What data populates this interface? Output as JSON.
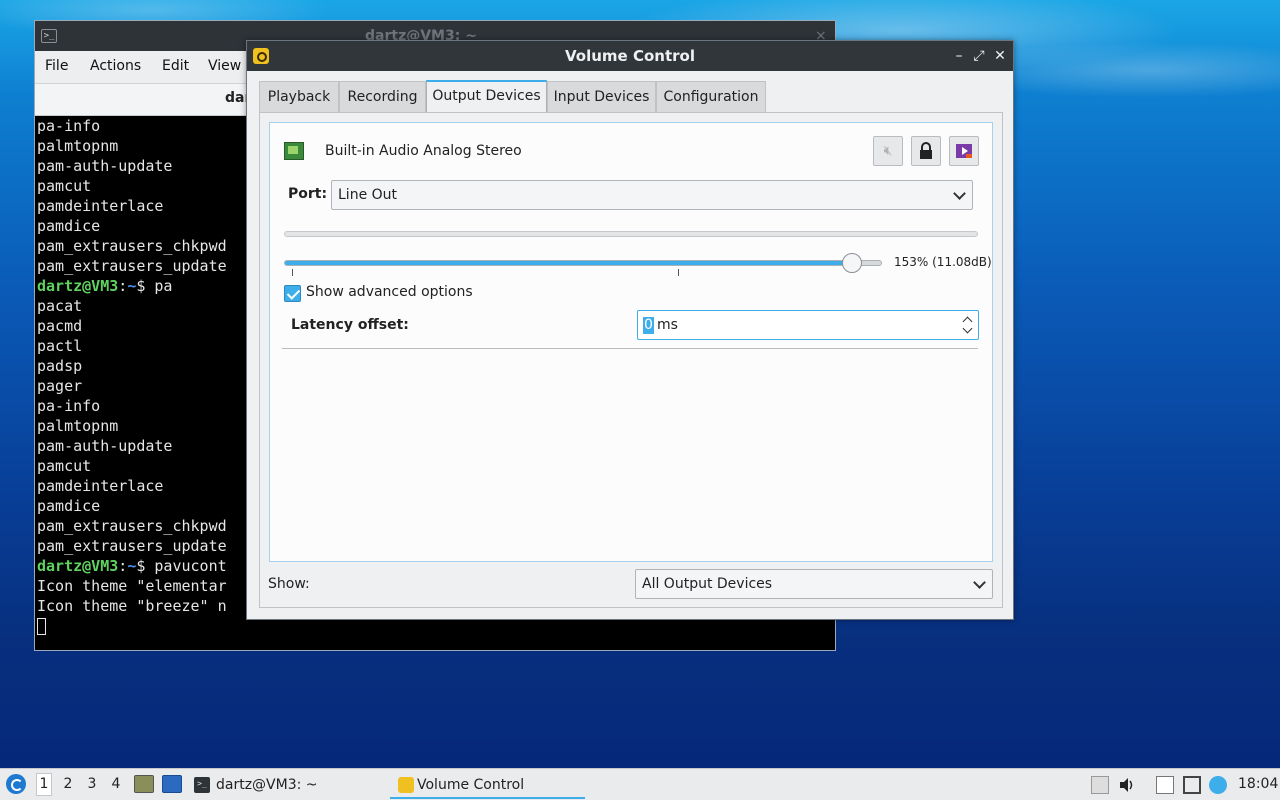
{
  "terminal": {
    "title": "dartz@VM3: ~",
    "close_glyph": "×",
    "menu": [
      "File",
      "Actions",
      "Edit",
      "View"
    ],
    "tab_label": "dar",
    "lines": [
      {
        "type": "text",
        "text": "pa-info"
      },
      {
        "type": "text",
        "text": "palmtopnm"
      },
      {
        "type": "text",
        "text": "pam-auth-update"
      },
      {
        "type": "text",
        "text": "pamcut"
      },
      {
        "type": "text",
        "text": "pamdeinterlace"
      },
      {
        "type": "text",
        "text": "pamdice"
      },
      {
        "type": "text",
        "text": "pam_extrausers_chkpwd"
      },
      {
        "type": "text",
        "text": "pam_extrausers_update"
      },
      {
        "type": "prompt",
        "user": "dartz@VM3",
        "path": "~",
        "cmd": " pa"
      },
      {
        "type": "text",
        "text": "pacat"
      },
      {
        "type": "text",
        "text": "pacmd"
      },
      {
        "type": "text",
        "text": "pactl"
      },
      {
        "type": "text",
        "text": "padsp"
      },
      {
        "type": "text",
        "text": "pager"
      },
      {
        "type": "text",
        "text": "pa-info"
      },
      {
        "type": "text",
        "text": "palmtopnm"
      },
      {
        "type": "text",
        "text": "pam-auth-update"
      },
      {
        "type": "text",
        "text": "pamcut"
      },
      {
        "type": "text",
        "text": "pamdeinterlace"
      },
      {
        "type": "text",
        "text": "pamdice"
      },
      {
        "type": "text",
        "text": "pam_extrausers_chkpwd"
      },
      {
        "type": "text",
        "text": "pam_extrausers_update"
      },
      {
        "type": "prompt",
        "user": "dartz@VM3",
        "path": "~",
        "cmd": " pavucont"
      },
      {
        "type": "text",
        "text": "Icon theme \"elementar"
      },
      {
        "type": "text",
        "text": "Icon theme \"breeze\" n"
      },
      {
        "type": "cursor"
      }
    ]
  },
  "volume_control": {
    "title": "Volume Control",
    "window_buttons": {
      "minimize": "–",
      "maximize": "⤢",
      "close": "✕"
    },
    "tabs": [
      "Playback",
      "Recording",
      "Output Devices",
      "Input Devices",
      "Configuration"
    ],
    "active_tab": "Output Devices",
    "device": {
      "name": "Built-in Audio Analog Stereo",
      "port_label": "Port:",
      "port_value": "Line Out",
      "volume_text": "153% (11.08dB)",
      "volume_fraction": 0.95,
      "show_advanced_label": "Show advanced options",
      "show_advanced_checked": true,
      "latency_label": "Latency offset:",
      "latency_value": "0",
      "latency_unit": "ms"
    },
    "show_label": "Show:",
    "show_value": "All Output Devices"
  },
  "taskbar": {
    "workspaces": [
      "1",
      "2",
      "3",
      "4"
    ],
    "active_workspace": "1",
    "tasks": [
      {
        "label": "dartz@VM3: ~",
        "icon": "terminal-icon"
      },
      {
        "label": "Volume Control",
        "icon": "volume-control-icon"
      }
    ],
    "clock": "18:04"
  },
  "colors": {
    "accent": "#3daee9",
    "titlebar": "#31363b",
    "prompt_user": "#5fd35f",
    "prompt_path": "#4f8ff0"
  }
}
